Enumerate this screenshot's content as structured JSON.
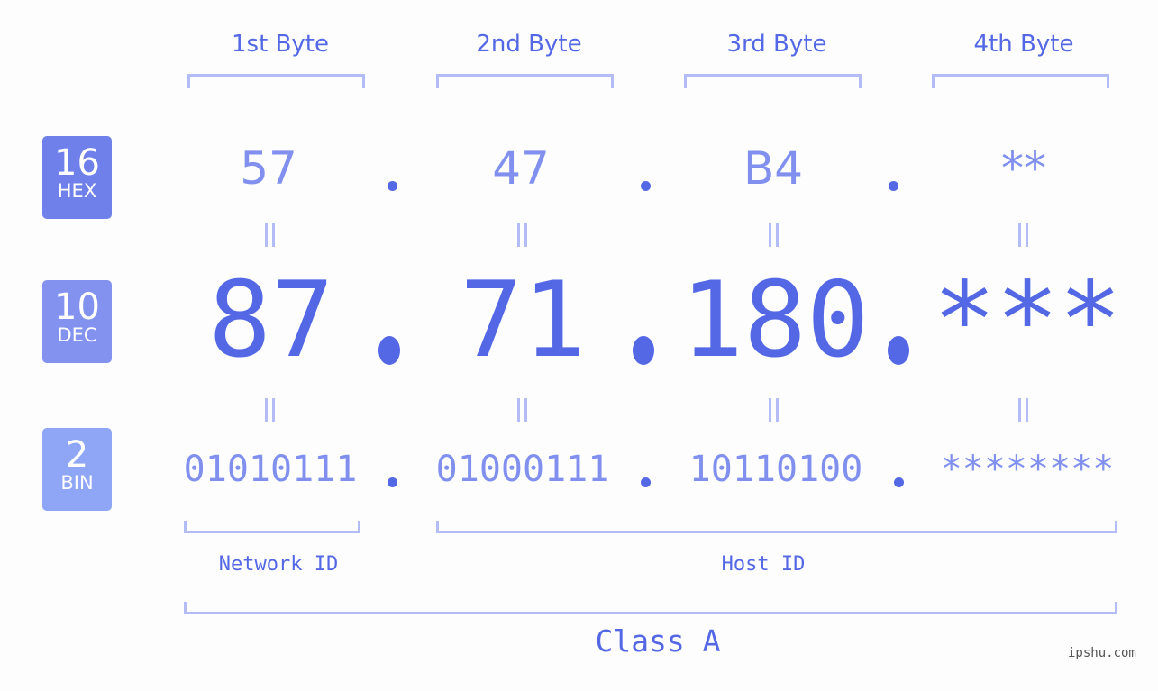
{
  "bases": [
    {
      "num": "16",
      "label": "HEX",
      "color": "#6f80ea"
    },
    {
      "num": "10",
      "label": "DEC",
      "color": "#8391ef"
    },
    {
      "num": "2",
      "label": "BIN",
      "color": "#8fa6f6"
    }
  ],
  "byte_headers": [
    "1st Byte",
    "2nd Byte",
    "3rd Byte",
    "4th Byte"
  ],
  "hex": [
    "57",
    "47",
    "B4",
    "**"
  ],
  "dec": [
    "87",
    "71",
    "180",
    "***"
  ],
  "bin": [
    "01010111",
    "01000111",
    "10110100",
    "********"
  ],
  "separator": ".",
  "network_id_label": "Network ID",
  "host_id_label": "Host ID",
  "class_label": "Class A",
  "watermark": "ipshu.com",
  "colors": {
    "accent": "#5468e6",
    "light": "#8190ee",
    "bracket": "#b3bcf5"
  }
}
